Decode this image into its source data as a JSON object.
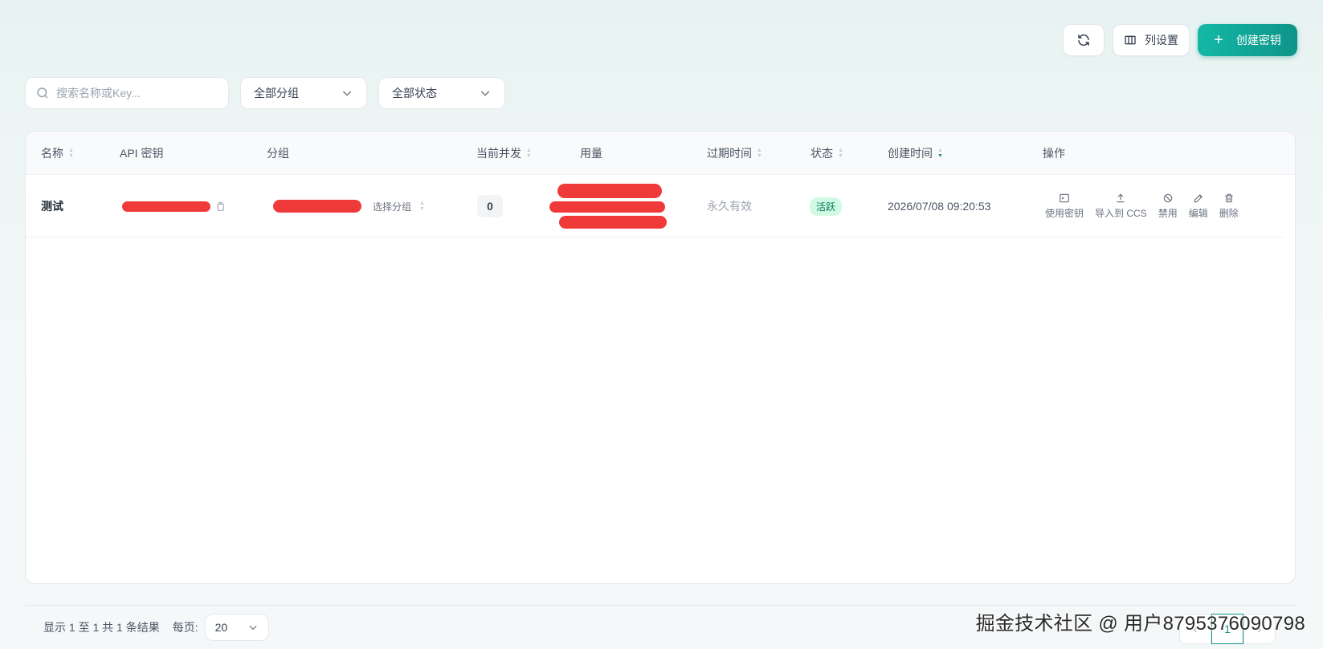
{
  "toolbar": {
    "columns_label": "列设置",
    "create_label": "创建密钥"
  },
  "filters": {
    "search_placeholder": "搜索名称或Key...",
    "group_select": "全部分组",
    "status_select": "全部状态"
  },
  "table": {
    "headers": {
      "name": "名称",
      "api_key": "API 密钥",
      "group": "分组",
      "concurrency": "当前并发",
      "usage": "用量",
      "expires": "过期时间",
      "status": "状态",
      "created": "创建时间",
      "actions": "操作"
    },
    "rows": [
      {
        "name": "测试",
        "group_select": "选择分组",
        "concurrency": "0",
        "expires": "永久有效",
        "status": "活跃",
        "created": "2026/07/08 09:20:53"
      }
    ],
    "actions": {
      "use": "使用密钥",
      "import": "导入到 CCS",
      "disable": "禁用",
      "edit": "编辑",
      "delete": "删除"
    }
  },
  "footer": {
    "summary": "显示 1 至 1 共 1 条结果",
    "per_page_label": "每页:",
    "per_page_value": "20",
    "current_page": "1"
  },
  "watermark": "掘金技术社区 @ 用户8795376090798",
  "colors": {
    "accent": "#0d9488",
    "status_active_bg": "#d1fae5",
    "redaction": "#f03a3a"
  }
}
